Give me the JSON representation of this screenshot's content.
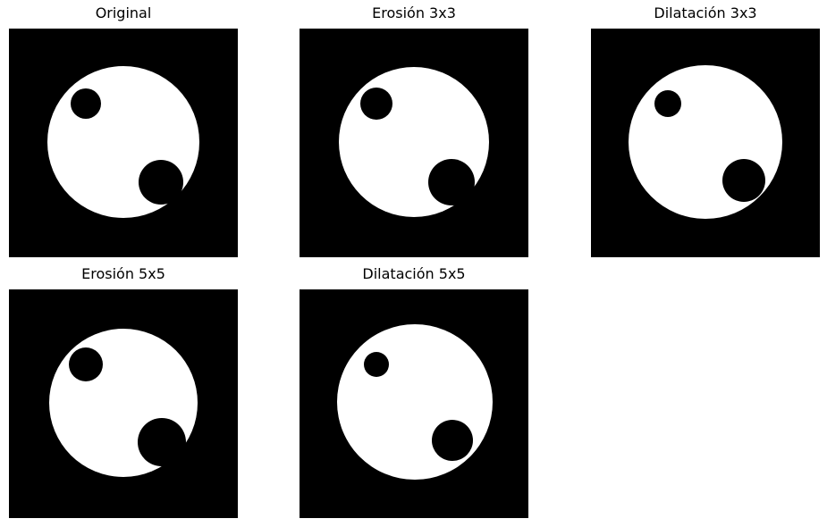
{
  "figure": {
    "panels": [
      {
        "title": "Original"
      },
      {
        "title": "Erosión 3x3"
      },
      {
        "title": "Dilatación 3x3"
      },
      {
        "title": "Erosión 5x5"
      },
      {
        "title": "Dilatación 5x5"
      }
    ]
  },
  "colors": {
    "background": "#000000",
    "foreground": "#ffffff"
  }
}
